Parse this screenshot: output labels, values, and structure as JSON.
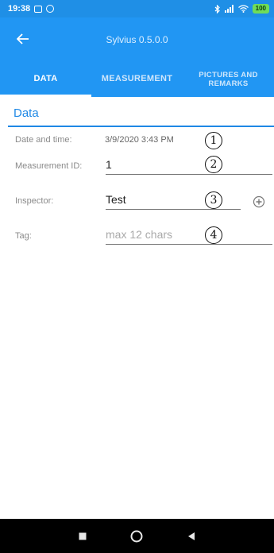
{
  "status_bar": {
    "time": "19:38",
    "battery": "100"
  },
  "app_bar": {
    "title": "Sylvius 0.5.0.0"
  },
  "tabs": [
    {
      "label": "DATA",
      "active": true
    },
    {
      "label": "MEASUREMENT",
      "active": false
    },
    {
      "label_line1": "PICTURES AND",
      "label_line2": "REMARKS",
      "active": false
    }
  ],
  "section": {
    "title": "Data"
  },
  "form": {
    "date_time": {
      "label": "Date and time:",
      "value": "3/9/2020 3:43 PM",
      "marker": "1"
    },
    "measurement_id": {
      "label": "Measurement ID:",
      "value": "1",
      "marker": "2"
    },
    "inspector": {
      "label": "Inspector:",
      "value": "Test",
      "marker": "3"
    },
    "tag": {
      "label": "Tag:",
      "value": "",
      "placeholder": "max 12 chars",
      "marker": "4"
    }
  },
  "colors": {
    "status_bar": "#1f8fe6",
    "app_bar": "#2196f3",
    "accent": "#1e88e5"
  }
}
